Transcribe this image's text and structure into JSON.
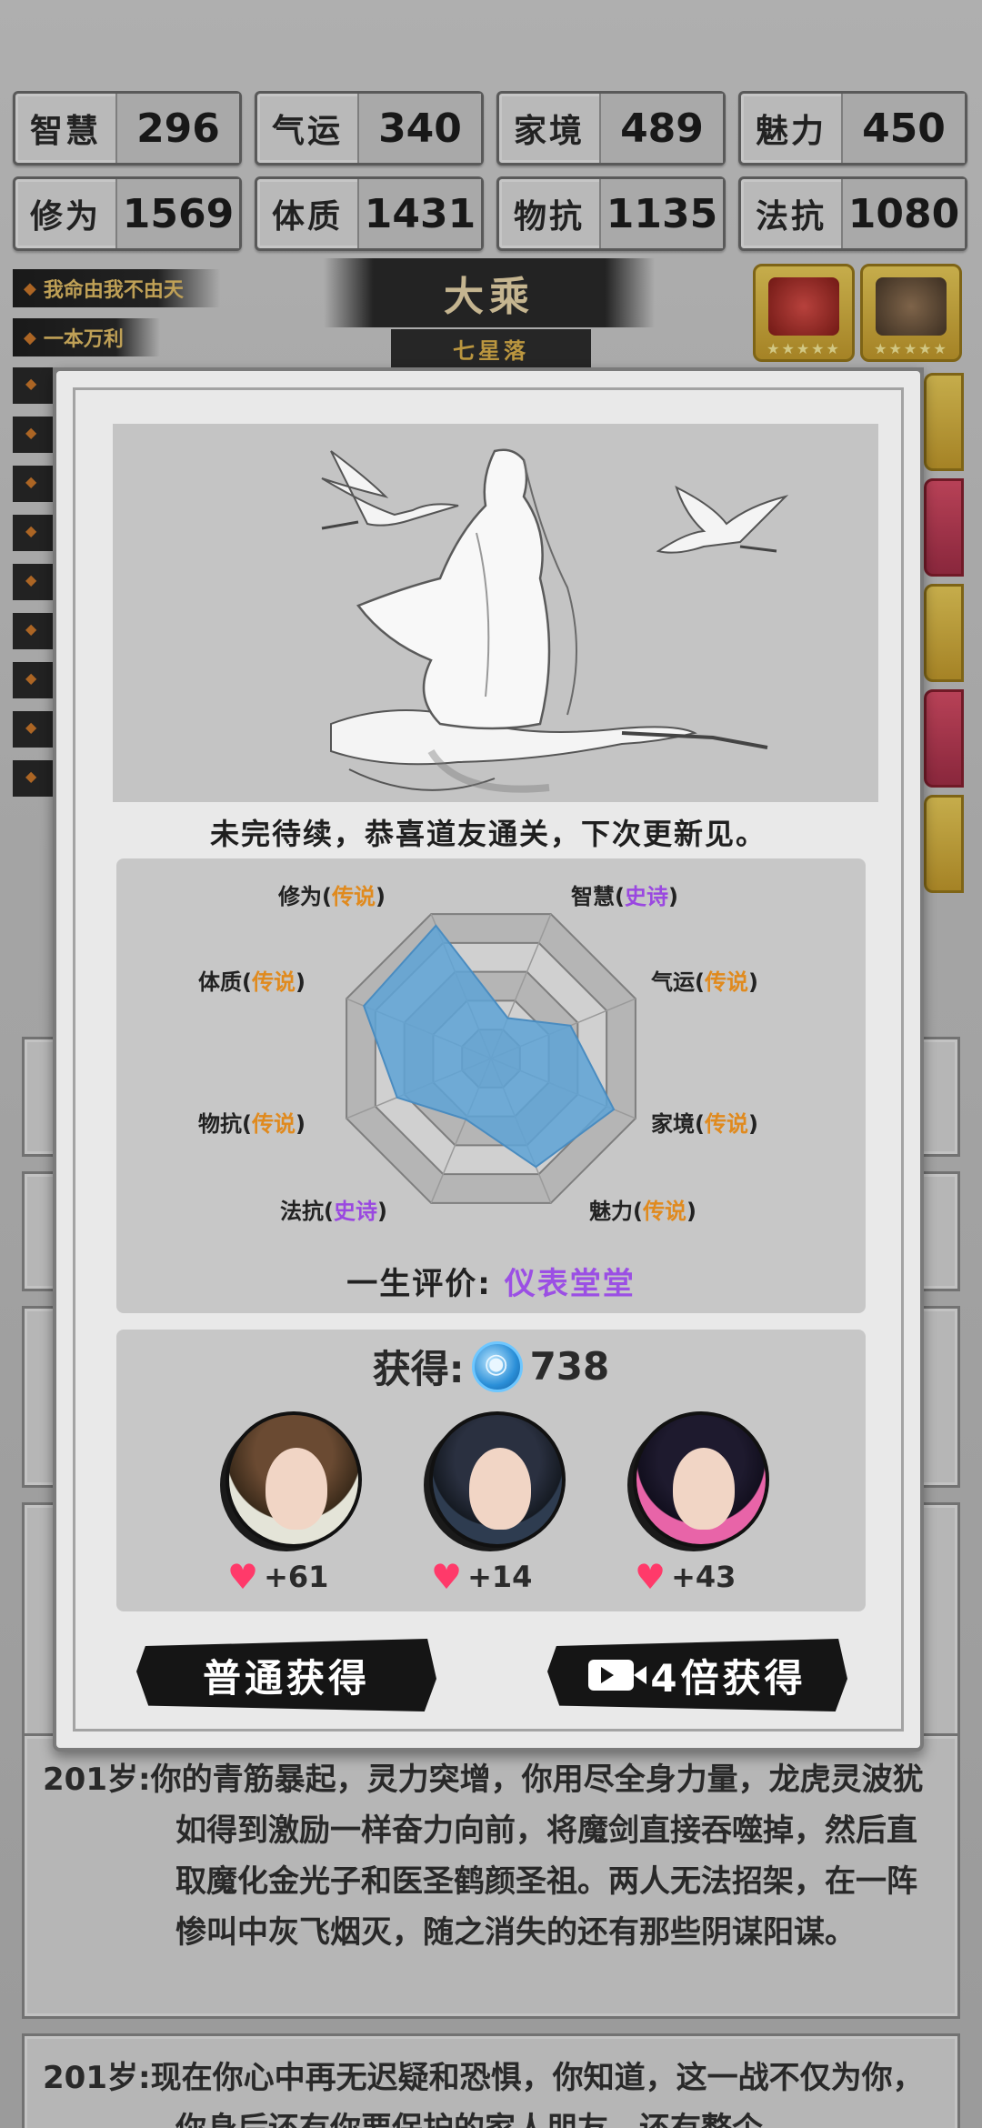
{
  "stats": [
    {
      "label": "智慧",
      "value": "296"
    },
    {
      "label": "气运",
      "value": "340"
    },
    {
      "label": "家境",
      "value": "489"
    },
    {
      "label": "魅力",
      "value": "450"
    },
    {
      "label": "修为",
      "value": "1569"
    },
    {
      "label": "体质",
      "value": "1431"
    },
    {
      "label": "物抗",
      "value": "1135"
    },
    {
      "label": "法抗",
      "value": "1080"
    }
  ],
  "tags": [
    "我命由我不由天",
    "一本万利"
  ],
  "realm": {
    "name": "大乘",
    "sub": "七星落"
  },
  "modal": {
    "message": "未完待续，恭喜道友通关，下次更新见。",
    "radar": {
      "labels": [
        {
          "name": "修为",
          "grade": "传说",
          "tier": "legend"
        },
        {
          "name": "智慧",
          "grade": "史诗",
          "tier": "epic"
        },
        {
          "name": "气运",
          "grade": "传说",
          "tier": "legend"
        },
        {
          "name": "家境",
          "grade": "传说",
          "tier": "legend"
        },
        {
          "name": "魅力",
          "grade": "传说",
          "tier": "legend"
        },
        {
          "name": "法抗",
          "grade": "史诗",
          "tier": "epic"
        },
        {
          "name": "物抗",
          "grade": "传说",
          "tier": "legend"
        },
        {
          "name": "体质",
          "grade": "传说",
          "tier": "legend"
        }
      ],
      "levels": [
        0.92,
        0.28,
        0.55,
        0.85,
        0.75,
        0.42,
        0.65,
        0.88
      ],
      "fill_color": "#5ea3d6"
    },
    "evaluation_label": "一生评价:",
    "evaluation_value": "仪表堂堂",
    "reward_label": "获得:",
    "reward_amount": "738",
    "characters": [
      {
        "heart": "+61"
      },
      {
        "heart": "+14"
      },
      {
        "heart": "+43"
      }
    ],
    "normal_button": "普通获得",
    "ad_button": "4倍获得"
  },
  "log": {
    "entry1": {
      "age": "201岁:",
      "text": "你的青筋暴起，灵力突增，你用尽全身力量，龙虎灵波犹如得到激励一样奋力向前，将魔剑直接吞噬掉，然后直取魔化金光子和医圣鹤颜圣祖。两人无法招架，在一阵惨叫中灰飞烟灭，随之消失的还有那些阴谋阳谋。"
    },
    "entry2": {
      "age": "201岁:",
      "text": "现在你心中再无迟疑和恐惧，你知道，这一战不仅为你，你身后还有你要保护的家人朋友，还有整个"
    }
  },
  "colors": {
    "legend": "#e08a1e",
    "epic": "#9a48e0",
    "heart": "#ff3a6a"
  }
}
